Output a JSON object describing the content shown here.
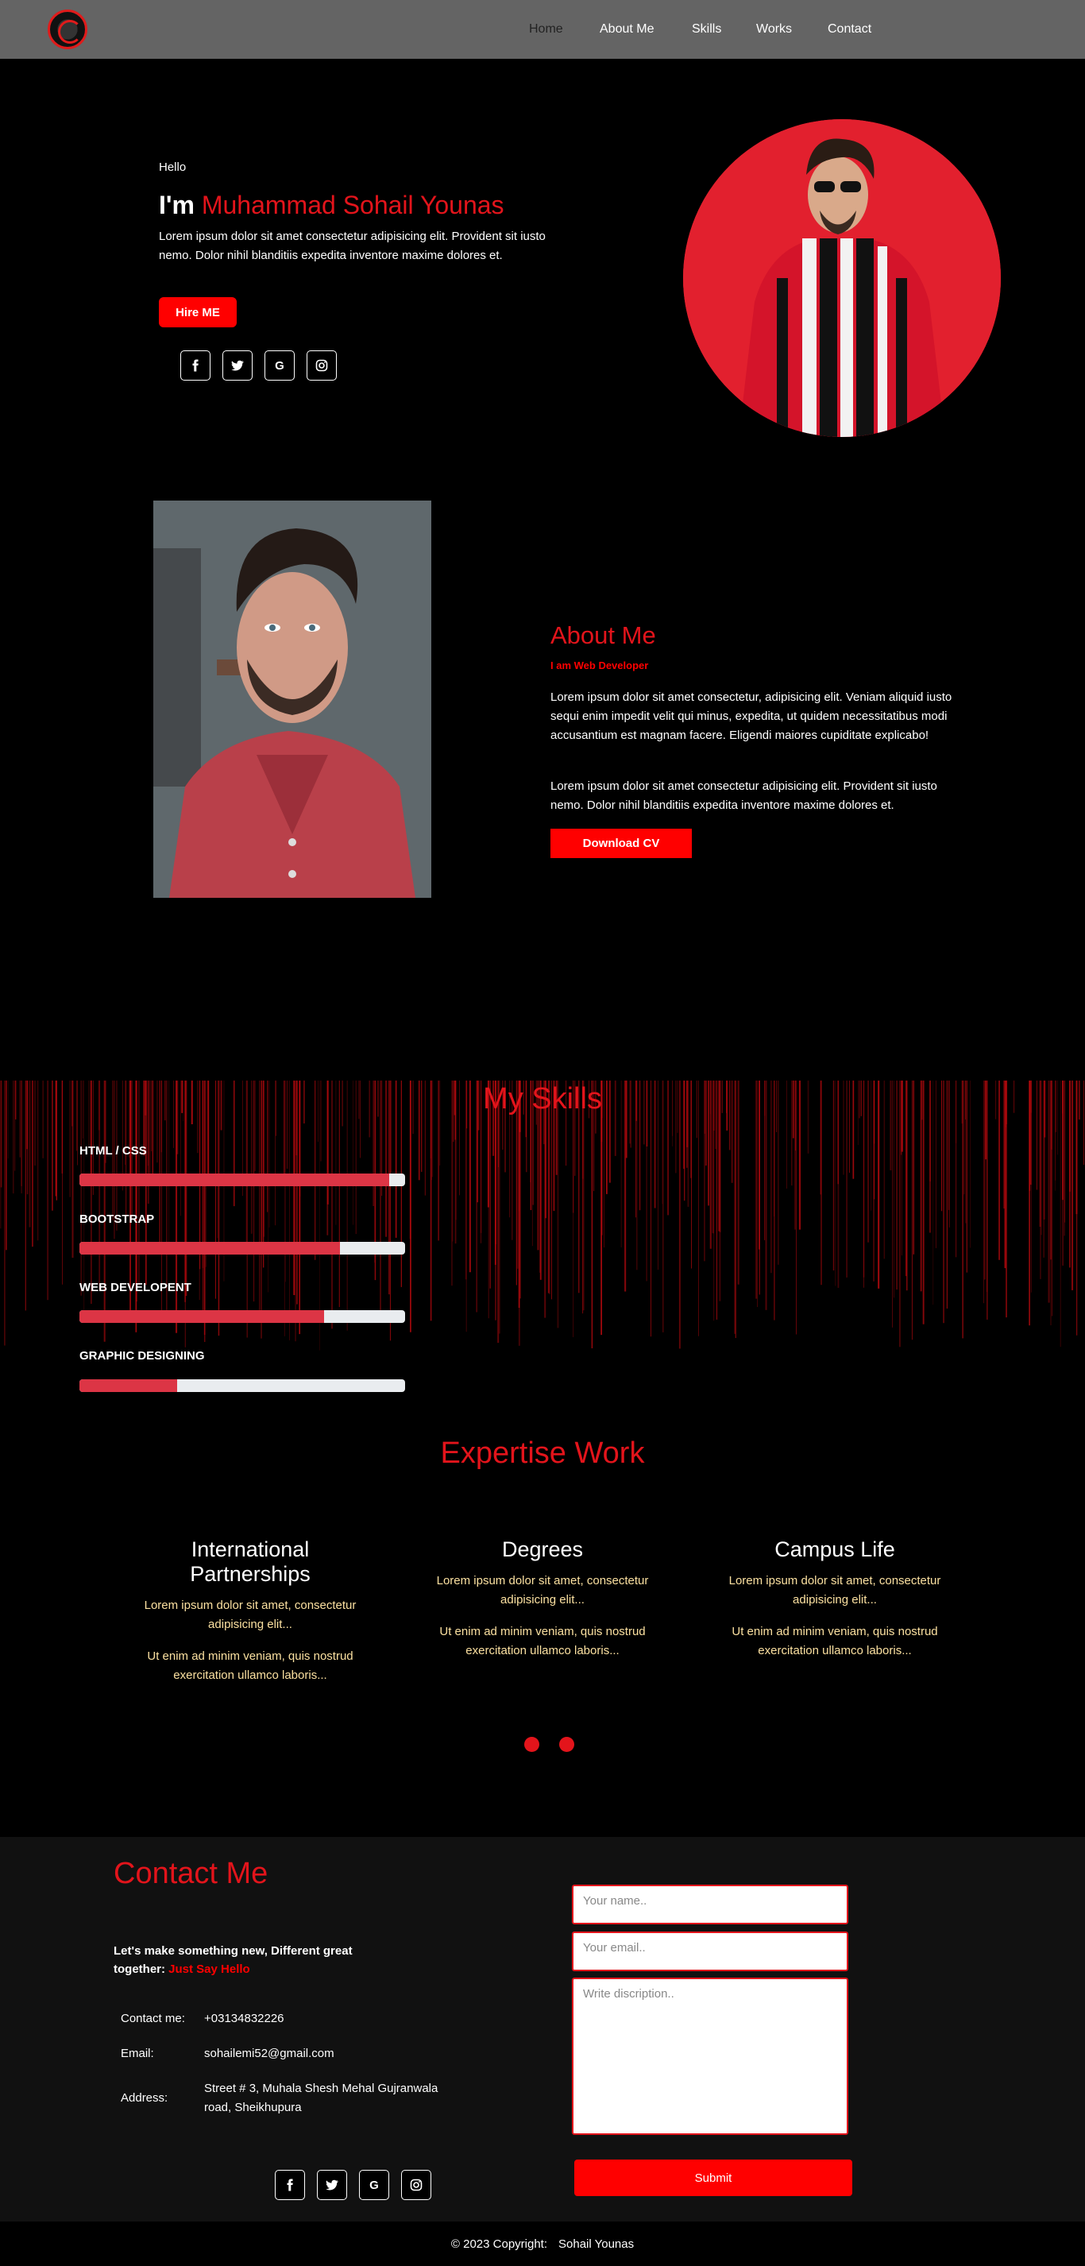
{
  "nav": {
    "links": [
      "Home",
      "About Me",
      "Skills",
      "Works",
      "Contact"
    ]
  },
  "hero": {
    "greeting": "Hello",
    "title_prefix": "I'm",
    "name": "Muhammad Sohail Younas",
    "description": "Lorem ipsum dolor sit amet consectetur adipisicing elit. Provident sit iusto nemo. Dolor nihil blanditiis expedita inventore maxime dolores et.",
    "hire_label": "Hire ME",
    "socials": [
      "facebook-icon",
      "twitter-icon",
      "google-icon",
      "instagram-icon"
    ]
  },
  "about": {
    "title": "About Me",
    "subtitle": "I am Web Developer",
    "p1": "Lorem ipsum dolor sit amet consectetur, adipisicing elit. Veniam aliquid iusto sequi enim impedit velit qui minus, expedita, ut quidem necessitatibus modi accusantium est magnam facere. Eligendi maiores cupiditate explicabo!",
    "p2": "Lorem ipsum dolor sit amet consectetur adipisicing elit. Provident sit iusto nemo. Dolor nihil blanditiis expedita inventore maxime dolores et.",
    "cv_label": "Download CV"
  },
  "skills": {
    "title": "My Skills",
    "items": [
      {
        "label": "HTML / CSS",
        "level": 0.95
      },
      {
        "label": "BOOTSTRAP",
        "level": 0.8
      },
      {
        "label": "WEB DEVELOPENT",
        "level": 0.75
      },
      {
        "label": "GRAPHIC DESIGNING",
        "level": 0.3
      }
    ]
  },
  "expertise": {
    "title": "Expertise Work",
    "cards": [
      {
        "title": "International Partnerships",
        "p1": "Lorem ipsum dolor sit amet, consectetur adipisicing elit...",
        "p2": "Ut enim ad minim veniam, quis nostrud exercitation ullamco laboris..."
      },
      {
        "title": "Degrees",
        "p1": "Lorem ipsum dolor sit amet, consectetur adipisicing elit...",
        "p2": "Ut enim ad minim veniam, quis nostrud exercitation ullamco laboris..."
      },
      {
        "title": "Campus Life",
        "p1": "Lorem ipsum dolor sit amet, consectetur adipisicing elit...",
        "p2": "Ut enim ad minim veniam, quis nostrud exercitation ullamco laboris..."
      }
    ]
  },
  "contact": {
    "title": "Contact Me",
    "tagline": "Let's make something new, Different great together:",
    "tagline_red": "Just Say Hello",
    "phone_label": "Contact me:",
    "phone": "+03134832226",
    "email_label": "Email:",
    "email": "sohailemi52@gmail.com",
    "address_label": "Address:",
    "address": "Street # 3, Muhala Shesh Mehal Gujranwala road, Sheikhupura",
    "name_placeholder": "Your name..",
    "email_placeholder": "Your email..",
    "desc_placeholder": "Write discription..",
    "submit_label": "Submit"
  },
  "footer": {
    "copyright": "© 2023 Copyright:",
    "name": "Sohail Younas"
  },
  "colors": {
    "accent": "#e3141b",
    "button": "#ff0000",
    "skill_fill": "#dc3545",
    "nav_bg": "#646464"
  }
}
